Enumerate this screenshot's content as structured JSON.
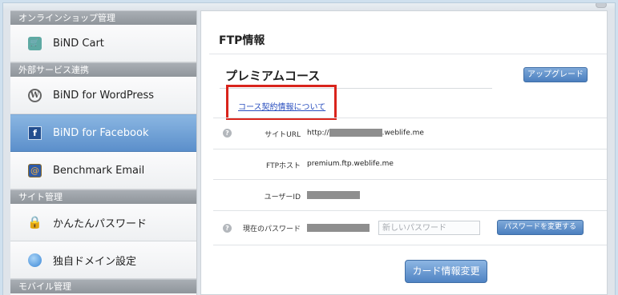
{
  "sidebar": {
    "sections": [
      {
        "header": "オンラインショップ管理",
        "items": [
          {
            "label": "BiND Cart",
            "icon": "cart-icon"
          }
        ]
      },
      {
        "header": "外部サービス連携",
        "items": [
          {
            "label": "BiND for WordPress",
            "icon": "wordpress-icon"
          },
          {
            "label": "BiND for Facebook",
            "icon": "facebook-icon",
            "active": true
          },
          {
            "label": "Benchmark Email",
            "icon": "benchmark-email-icon"
          }
        ]
      },
      {
        "header": "サイト管理",
        "items": [
          {
            "label": "かんたんパスワード",
            "icon": "lock-icon"
          },
          {
            "label": "独自ドメイン設定",
            "icon": "globe-icon"
          }
        ]
      },
      {
        "header": "モバイル管理"
      }
    ]
  },
  "main": {
    "title": "FTP情報",
    "course_title": "プレミアムコース",
    "upgrade_button": "アップグレード",
    "contract_link": "コース契約情報について",
    "fields": {
      "site_url_label": "サイトURL",
      "site_url_prefix": "http://",
      "site_url_suffix": ".weblife.me",
      "ftp_host_label": "FTPホスト",
      "ftp_host_value": "premium.ftp.weblife.me",
      "user_id_label": "ユーザーID",
      "current_password_label": "現在のパスワード",
      "new_password_placeholder": "新しいパスワード"
    },
    "change_password_button": "パスワードを変更する",
    "card_button": "カード情報変更"
  },
  "colors": {
    "active_item": "#5b8fcb",
    "button_blue": "#4b7fbf",
    "highlight_red": "#d9241c",
    "link_blue": "#2a4fbf"
  }
}
